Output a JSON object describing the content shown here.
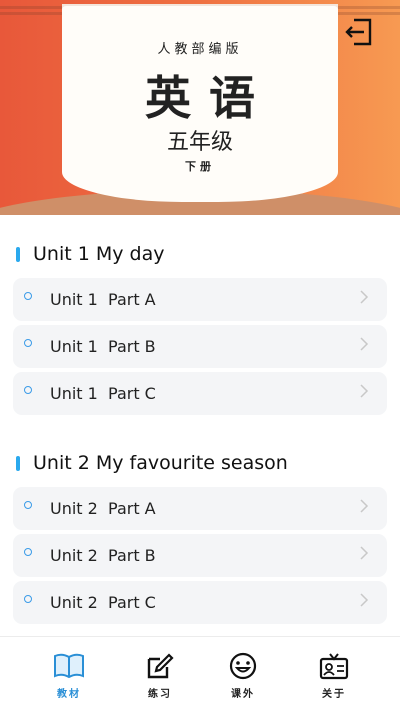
{
  "header": {
    "publisher": "人教部编版",
    "subject": "英语",
    "grade": "五年级",
    "term": "下册"
  },
  "units": [
    {
      "title": "Unit 1 My day",
      "parts": [
        "Unit 1  Part A",
        "Unit 1  Part B",
        "Unit 1  Part C"
      ]
    },
    {
      "title": "Unit 2 My favourite season",
      "parts": [
        "Unit 2  Part A",
        "Unit 2  Part B",
        "Unit 2  Part C"
      ]
    }
  ],
  "tabs": [
    {
      "label": "教材",
      "icon": "book-icon",
      "active": true
    },
    {
      "label": "练习",
      "icon": "edit-icon",
      "active": false
    },
    {
      "label": "课外",
      "icon": "smiley-icon",
      "active": false
    },
    {
      "label": "关于",
      "icon": "id-card-icon",
      "active": false
    }
  ],
  "colors": {
    "accent": "#2aa9ee",
    "banner_left": "#e8583a",
    "banner_right": "#f79a52"
  }
}
